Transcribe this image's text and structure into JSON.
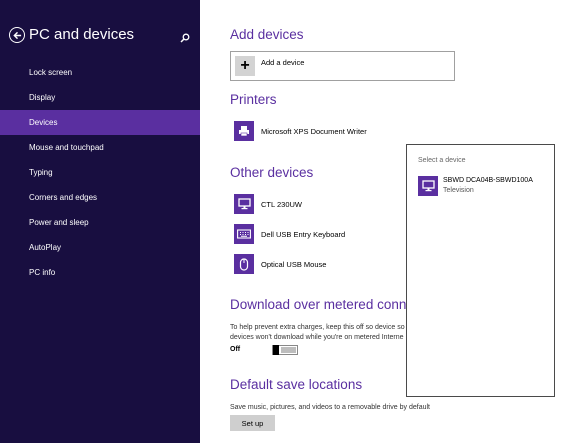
{
  "sidebar": {
    "title": "PC and devices",
    "items": [
      {
        "label": "Lock screen",
        "active": false
      },
      {
        "label": "Display",
        "active": false
      },
      {
        "label": "Devices",
        "active": true
      },
      {
        "label": "Mouse and touchpad",
        "active": false
      },
      {
        "label": "Typing",
        "active": false
      },
      {
        "label": "Corners and edges",
        "active": false
      },
      {
        "label": "Power and sleep",
        "active": false
      },
      {
        "label": "AutoPlay",
        "active": false
      },
      {
        "label": "PC info",
        "active": false
      }
    ]
  },
  "main": {
    "add_devices": {
      "heading": "Add devices",
      "add_label": "Add a device"
    },
    "printers": {
      "heading": "Printers",
      "items": [
        {
          "label": "Microsoft XPS Document Writer",
          "icon": "printer-icon"
        }
      ]
    },
    "other_devices": {
      "heading": "Other devices",
      "items": [
        {
          "label": "CTL 230UW",
          "icon": "monitor-icon"
        },
        {
          "label": "Dell USB Entry Keyboard",
          "icon": "keyboard-icon"
        },
        {
          "label": "Optical USB Mouse",
          "icon": "mouse-icon"
        }
      ]
    },
    "metered": {
      "heading": "Download over metered conne",
      "desc_line1": "To help prevent extra charges, keep this off so device so",
      "desc_line2": "devices won't download while you're on metered Interne",
      "toggle_label": "Off",
      "toggle_on": false
    },
    "save_locations": {
      "heading": "Default save locations",
      "desc": "Save music, pictures, and videos to a removable drive by default",
      "setup_label": "Set up"
    }
  },
  "popup": {
    "title": "Select a device",
    "item": {
      "name": "SBWD DCA04B-SBWD100A",
      "sub": "Television",
      "icon": "monitor-icon"
    }
  },
  "colors": {
    "sidebar_bg": "#180e40",
    "accent": "#5a2fa0",
    "popup_border": "#4a4a4a"
  }
}
